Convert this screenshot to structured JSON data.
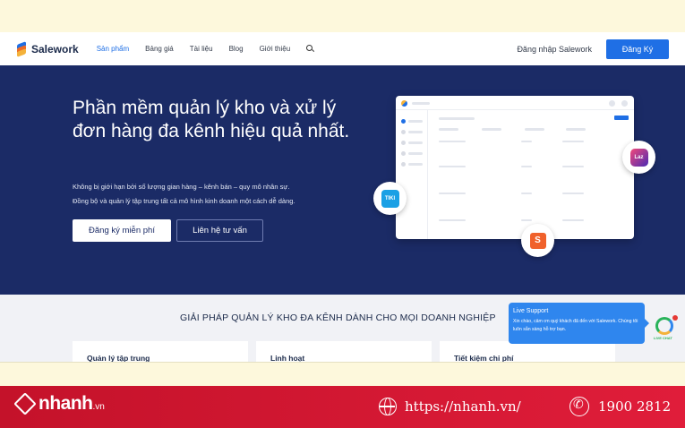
{
  "navbar": {
    "brand": "Salework",
    "links": [
      "Sản phẩm",
      "Bảng giá",
      "Tài liệu",
      "Blog",
      "Giới thiệu"
    ],
    "login": "Đăng nhập Salework",
    "signup": "Đăng Ký"
  },
  "hero": {
    "title": "Phần mềm quản lý kho và xử lý đơn hàng đa kênh hiệu quả nhất.",
    "subtitle_1": "Không bị giới hạn bởi số lượng gian hàng – kênh bán – quy mô nhân sự.",
    "subtitle_2": "Đồng bộ và quản lý tập trung tất cả mô hình kinh doanh một cách dễ dàng.",
    "primary_cta": "Đăng ký miễn phí",
    "secondary_cta": "Liên hệ tư vấn",
    "badges": {
      "tiki": "TIKI",
      "lazada": "Laz",
      "shopee": "S"
    }
  },
  "solutions": {
    "title": "GIẢI PHÁP QUẢN LÝ KHO ĐA KÊNH DÀNH CHO MỌI DOANH NGHIỆP",
    "cards": [
      "Quản lý tập trung",
      "Linh hoạt",
      "Tiết kiệm chi phí"
    ]
  },
  "live_support": {
    "title": "Live Support",
    "message": "Xin chào, cảm ơn quý khách đã đến với Salework. Chúng tôi luôn sẵn sàng hỗ trợ bạn.",
    "widget_label": "LIVE CHAT"
  },
  "footer": {
    "brand": "nhanh",
    "tld": ".vn",
    "url": "https://nhanh.vn/",
    "phone": "1900 2812"
  },
  "colors": {
    "accent": "#1f6fe5",
    "hero_bg": "#1b2b66",
    "footer_red": "#d0182f"
  }
}
